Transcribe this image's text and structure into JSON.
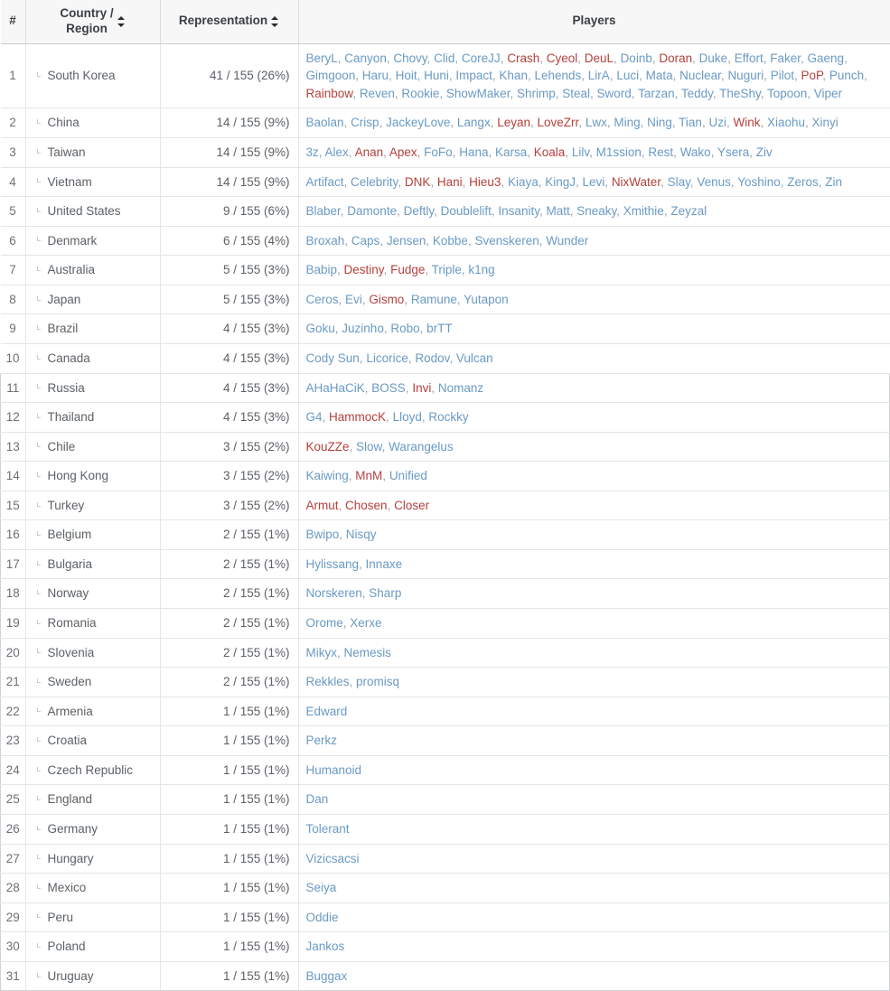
{
  "table": {
    "columns": {
      "num": "#",
      "country_line1": "Country /",
      "country_line2": "Region",
      "representation": "Representation",
      "players": "Players"
    },
    "colors": {
      "player_link": "#6a9ac4",
      "player_highlight": "#b5403c",
      "header_bg": "#f7f7f7",
      "text": "#5c6166"
    },
    "rows": [
      {
        "num": "1",
        "country": "South Korea",
        "representation": "41 / 155 (26%)",
        "players": [
          {
            "n": "BeryL",
            "h": false
          },
          {
            "n": "Canyon",
            "h": false
          },
          {
            "n": "Chovy",
            "h": false
          },
          {
            "n": "Clid",
            "h": false
          },
          {
            "n": "CoreJJ",
            "h": false
          },
          {
            "n": "Crash",
            "h": true
          },
          {
            "n": "Cyeol",
            "h": true
          },
          {
            "n": "DeuL",
            "h": true
          },
          {
            "n": "Doinb",
            "h": false
          },
          {
            "n": "Doran",
            "h": true
          },
          {
            "n": "Duke",
            "h": false
          },
          {
            "n": "Effort",
            "h": false
          },
          {
            "n": "Faker",
            "h": false
          },
          {
            "n": "Gaeng",
            "h": false
          },
          {
            "n": "Gimgoon",
            "h": false
          },
          {
            "n": "Haru",
            "h": false
          },
          {
            "n": "Hoit",
            "h": false
          },
          {
            "n": "Huni",
            "h": false
          },
          {
            "n": "Impact",
            "h": false
          },
          {
            "n": "Khan",
            "h": false
          },
          {
            "n": "Lehends",
            "h": false
          },
          {
            "n": "LirA",
            "h": false
          },
          {
            "n": "Luci",
            "h": false
          },
          {
            "n": "Mata",
            "h": false
          },
          {
            "n": "Nuclear",
            "h": false
          },
          {
            "n": "Nuguri",
            "h": false
          },
          {
            "n": "Pilot",
            "h": false
          },
          {
            "n": "PoP",
            "h": true
          },
          {
            "n": "Punch",
            "h": false
          },
          {
            "n": "Rainbow",
            "h": true
          },
          {
            "n": "Reven",
            "h": false
          },
          {
            "n": "Rookie",
            "h": false
          },
          {
            "n": "ShowMaker",
            "h": false
          },
          {
            "n": "Shrimp",
            "h": false
          },
          {
            "n": "Steal",
            "h": false
          },
          {
            "n": "Sword",
            "h": false
          },
          {
            "n": "Tarzan",
            "h": false
          },
          {
            "n": "Teddy",
            "h": false
          },
          {
            "n": "TheShy",
            "h": false
          },
          {
            "n": "Topoon",
            "h": false
          },
          {
            "n": "Viper",
            "h": false
          }
        ]
      },
      {
        "num": "2",
        "country": "China",
        "representation": "14 / 155 (9%)",
        "players": [
          {
            "n": "Baolan",
            "h": false
          },
          {
            "n": "Crisp",
            "h": false
          },
          {
            "n": "JackeyLove",
            "h": false
          },
          {
            "n": "Langx",
            "h": false
          },
          {
            "n": "Leyan",
            "h": true
          },
          {
            "n": "LoveZrr",
            "h": true
          },
          {
            "n": "Lwx",
            "h": false
          },
          {
            "n": "Ming",
            "h": false
          },
          {
            "n": "Ning",
            "h": false
          },
          {
            "n": "Tian",
            "h": false
          },
          {
            "n": "Uzi",
            "h": false
          },
          {
            "n": "Wink",
            "h": true
          },
          {
            "n": "Xiaohu",
            "h": false
          },
          {
            "n": "Xinyi",
            "h": false
          }
        ]
      },
      {
        "num": "3",
        "country": "Taiwan",
        "representation": "14 / 155 (9%)",
        "players": [
          {
            "n": "3z",
            "h": false
          },
          {
            "n": "Alex",
            "h": false
          },
          {
            "n": "Anan",
            "h": true
          },
          {
            "n": "Apex",
            "h": true
          },
          {
            "n": "FoFo",
            "h": false
          },
          {
            "n": "Hana",
            "h": false
          },
          {
            "n": "Karsa",
            "h": false
          },
          {
            "n": "Koala",
            "h": true
          },
          {
            "n": "Lilv",
            "h": false
          },
          {
            "n": "M1ssion",
            "h": false
          },
          {
            "n": "Rest",
            "h": false
          },
          {
            "n": "Wako",
            "h": false
          },
          {
            "n": "Ysera",
            "h": false
          },
          {
            "n": "Ziv",
            "h": false
          }
        ]
      },
      {
        "num": "4",
        "country": "Vietnam",
        "representation": "14 / 155 (9%)",
        "players": [
          {
            "n": "Artifact",
            "h": false
          },
          {
            "n": "Celebrity",
            "h": false
          },
          {
            "n": "DNK",
            "h": true
          },
          {
            "n": "Hani",
            "h": true
          },
          {
            "n": "Hieu3",
            "h": true
          },
          {
            "n": "Kiaya",
            "h": false
          },
          {
            "n": "KingJ",
            "h": false
          },
          {
            "n": "Levi",
            "h": false
          },
          {
            "n": "NixWater",
            "h": true
          },
          {
            "n": "Slay",
            "h": false
          },
          {
            "n": "Venus",
            "h": false
          },
          {
            "n": "Yoshino",
            "h": false
          },
          {
            "n": "Zeros",
            "h": false
          },
          {
            "n": "Zin",
            "h": false
          }
        ]
      },
      {
        "num": "5",
        "country": "United States",
        "representation": "9 / 155 (6%)",
        "players": [
          {
            "n": "Blaber",
            "h": false
          },
          {
            "n": "Damonte",
            "h": false
          },
          {
            "n": "Deftly",
            "h": false
          },
          {
            "n": "Doublelift",
            "h": false
          },
          {
            "n": "Insanity",
            "h": false
          },
          {
            "n": "Matt",
            "h": false
          },
          {
            "n": "Sneaky",
            "h": false
          },
          {
            "n": "Xmithie",
            "h": false
          },
          {
            "n": "Zeyzal",
            "h": false
          }
        ]
      },
      {
        "num": "6",
        "country": "Denmark",
        "representation": "6 / 155 (4%)",
        "players": [
          {
            "n": "Broxah",
            "h": false
          },
          {
            "n": "Caps",
            "h": false
          },
          {
            "n": "Jensen",
            "h": false
          },
          {
            "n": "Kobbe",
            "h": false
          },
          {
            "n": "Svenskeren",
            "h": false
          },
          {
            "n": "Wunder",
            "h": false
          }
        ]
      },
      {
        "num": "7",
        "country": "Australia",
        "representation": "5 / 155 (3%)",
        "players": [
          {
            "n": "Babip",
            "h": false
          },
          {
            "n": "Destiny",
            "h": true
          },
          {
            "n": "Fudge",
            "h": true
          },
          {
            "n": "Triple",
            "h": false
          },
          {
            "n": "k1ng",
            "h": false
          }
        ]
      },
      {
        "num": "8",
        "country": "Japan",
        "representation": "5 / 155 (3%)",
        "players": [
          {
            "n": "Ceros",
            "h": false
          },
          {
            "n": "Evi",
            "h": false
          },
          {
            "n": "Gismo",
            "h": true
          },
          {
            "n": "Ramune",
            "h": false
          },
          {
            "n": "Yutapon",
            "h": false
          }
        ]
      },
      {
        "num": "9",
        "country": "Brazil",
        "representation": "4 / 155 (3%)",
        "players": [
          {
            "n": "Goku",
            "h": false
          },
          {
            "n": "Juzinho",
            "h": false
          },
          {
            "n": "Robo",
            "h": false
          },
          {
            "n": "brTT",
            "h": false
          }
        ]
      },
      {
        "num": "10",
        "country": "Canada",
        "representation": "4 / 155 (3%)",
        "players": [
          {
            "n": "Cody Sun",
            "h": false
          },
          {
            "n": "Licorice",
            "h": false
          },
          {
            "n": "Rodov",
            "h": false
          },
          {
            "n": "Vulcan",
            "h": false
          }
        ]
      },
      {
        "num": "11",
        "country": "Russia",
        "representation": "4 / 155 (3%)",
        "players": [
          {
            "n": "AHaHaCiK",
            "h": false
          },
          {
            "n": "BOSS",
            "h": false
          },
          {
            "n": "Invi",
            "h": true
          },
          {
            "n": "Nomanz",
            "h": false
          }
        ]
      },
      {
        "num": "12",
        "country": "Thailand",
        "representation": "4 / 155 (3%)",
        "players": [
          {
            "n": "G4",
            "h": false
          },
          {
            "n": "HammocK",
            "h": true
          },
          {
            "n": "Lloyd",
            "h": false
          },
          {
            "n": "Rockky",
            "h": false
          }
        ]
      },
      {
        "num": "13",
        "country": "Chile",
        "representation": "3 / 155 (2%)",
        "players": [
          {
            "n": "KouZZe",
            "h": true
          },
          {
            "n": "Slow",
            "h": false
          },
          {
            "n": "Warangelus",
            "h": false
          }
        ]
      },
      {
        "num": "14",
        "country": "Hong Kong",
        "representation": "3 / 155 (2%)",
        "players": [
          {
            "n": "Kaiwing",
            "h": false
          },
          {
            "n": "MnM",
            "h": true
          },
          {
            "n": "Unified",
            "h": false
          }
        ]
      },
      {
        "num": "15",
        "country": "Turkey",
        "representation": "3 / 155 (2%)",
        "players": [
          {
            "n": "Armut",
            "h": true
          },
          {
            "n": "Chosen",
            "h": true
          },
          {
            "n": "Closer",
            "h": true
          }
        ]
      },
      {
        "num": "16",
        "country": "Belgium",
        "representation": "2 / 155 (1%)",
        "players": [
          {
            "n": "Bwipo",
            "h": false
          },
          {
            "n": "Nisqy",
            "h": false
          }
        ]
      },
      {
        "num": "17",
        "country": "Bulgaria",
        "representation": "2 / 155 (1%)",
        "players": [
          {
            "n": "Hylissang",
            "h": false
          },
          {
            "n": "Innaxe",
            "h": false
          }
        ]
      },
      {
        "num": "18",
        "country": "Norway",
        "representation": "2 / 155 (1%)",
        "players": [
          {
            "n": "Norskeren",
            "h": false
          },
          {
            "n": "Sharp",
            "h": false
          }
        ]
      },
      {
        "num": "19",
        "country": "Romania",
        "representation": "2 / 155 (1%)",
        "players": [
          {
            "n": "Orome",
            "h": false
          },
          {
            "n": "Xerxe",
            "h": false
          }
        ]
      },
      {
        "num": "20",
        "country": "Slovenia",
        "representation": "2 / 155 (1%)",
        "players": [
          {
            "n": "Mikyx",
            "h": false
          },
          {
            "n": "Nemesis",
            "h": false
          }
        ]
      },
      {
        "num": "21",
        "country": "Sweden",
        "representation": "2 / 155 (1%)",
        "players": [
          {
            "n": "Rekkles",
            "h": false
          },
          {
            "n": "promisq",
            "h": false
          }
        ]
      },
      {
        "num": "22",
        "country": "Armenia",
        "representation": "1 / 155 (1%)",
        "players": [
          {
            "n": "Edward",
            "h": false
          }
        ]
      },
      {
        "num": "23",
        "country": "Croatia",
        "representation": "1 / 155 (1%)",
        "players": [
          {
            "n": "Perkz",
            "h": false
          }
        ]
      },
      {
        "num": "24",
        "country": "Czech Republic",
        "representation": "1 / 155 (1%)",
        "players": [
          {
            "n": "Humanoid",
            "h": false
          }
        ]
      },
      {
        "num": "25",
        "country": "England",
        "representation": "1 / 155 (1%)",
        "players": [
          {
            "n": "Dan",
            "h": false
          }
        ]
      },
      {
        "num": "26",
        "country": "Germany",
        "representation": "1 / 155 (1%)",
        "players": [
          {
            "n": "Tolerant",
            "h": false
          }
        ]
      },
      {
        "num": "27",
        "country": "Hungary",
        "representation": "1 / 155 (1%)",
        "players": [
          {
            "n": "Vizicsacsi",
            "h": false
          }
        ]
      },
      {
        "num": "28",
        "country": "Mexico",
        "representation": "1 / 155 (1%)",
        "players": [
          {
            "n": "Seiya",
            "h": false
          }
        ]
      },
      {
        "num": "29",
        "country": "Peru",
        "representation": "1 / 155 (1%)",
        "players": [
          {
            "n": "Oddie",
            "h": false
          }
        ]
      },
      {
        "num": "30",
        "country": "Poland",
        "representation": "1 / 155 (1%)",
        "players": [
          {
            "n": "Jankos",
            "h": false
          }
        ]
      },
      {
        "num": "31",
        "country": "Uruguay",
        "representation": "1 / 155 (1%)",
        "players": [
          {
            "n": "Buggax",
            "h": false
          }
        ]
      }
    ]
  }
}
